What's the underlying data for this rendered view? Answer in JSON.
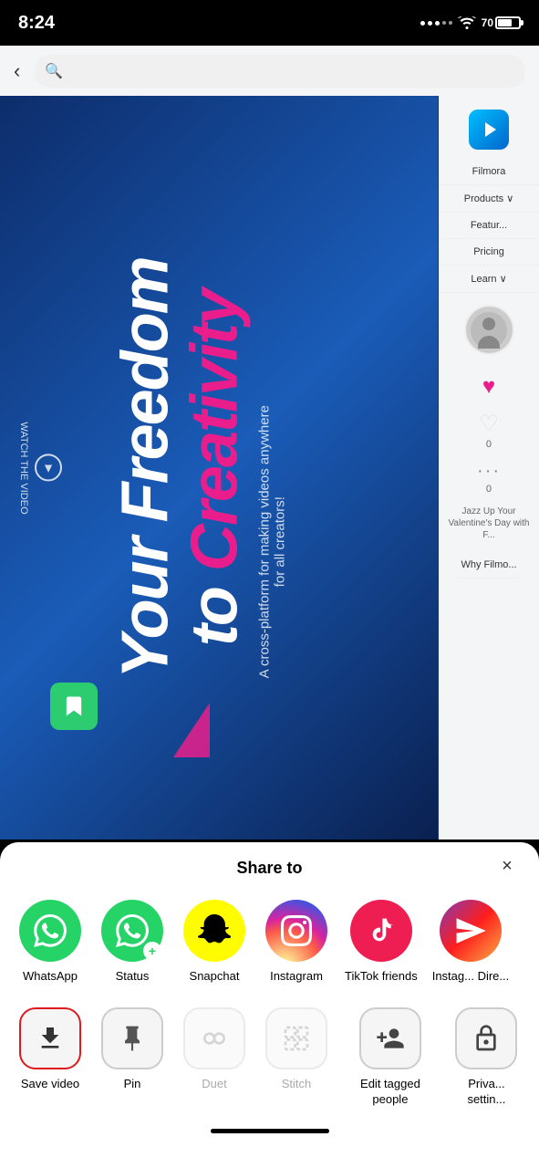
{
  "statusBar": {
    "time": "8:24",
    "batteryLevel": "70"
  },
  "browserNav": {
    "backLabel": "‹",
    "searchPlaceholder": ""
  },
  "heroContent": {
    "watchLabel": "WATCH THE VIDEO",
    "tagline": "A cross-platform for making videos anywhere for all creators!",
    "mainLine1": "Your Freedom",
    "mainLine2": "to Creativity"
  },
  "sidebarNav": {
    "logoAlt": "Filmora",
    "items": [
      {
        "label": "Filmora"
      },
      {
        "label": "Products ∨"
      },
      {
        "label": "Featur..."
      },
      {
        "label": "Pricing"
      },
      {
        "label": "Learn ∨"
      },
      {
        "label": "Why Filmo..."
      }
    ]
  },
  "shareSheet": {
    "title": "Share to",
    "closeLabel": "×",
    "row1": [
      {
        "id": "whatsapp",
        "label": "WhatsApp",
        "colorClass": "bg-whatsapp",
        "icon": "💬"
      },
      {
        "id": "status",
        "label": "Status",
        "colorClass": "bg-status",
        "icon": "🟢"
      },
      {
        "id": "snapchat",
        "label": "Snapchat",
        "colorClass": "bg-snapchat",
        "icon": "👻"
      },
      {
        "id": "instagram",
        "label": "Instagram",
        "colorClass": "bg-instagram",
        "icon": "📸"
      },
      {
        "id": "tiktok-friends",
        "label": "TikTok friends",
        "colorClass": "bg-tiktok",
        "icon": "✈"
      },
      {
        "id": "insta-direct",
        "label": "Instag... Dire...",
        "colorClass": "bg-instadirect",
        "icon": "⇰"
      }
    ],
    "row2": [
      {
        "id": "save-video",
        "label": "Save video",
        "icon": "⬇",
        "selected": true,
        "disabled": false
      },
      {
        "id": "pin",
        "label": "Pin",
        "icon": "📌",
        "selected": false,
        "disabled": false
      },
      {
        "id": "duet",
        "label": "Duet",
        "icon": "⊙",
        "selected": false,
        "disabled": true
      },
      {
        "id": "stitch",
        "label": "Stitch",
        "icon": "⊞",
        "selected": false,
        "disabled": true
      },
      {
        "id": "edit-tagged",
        "label": "Edit tagged people",
        "icon": "👤",
        "selected": false,
        "disabled": false
      },
      {
        "id": "private-settings",
        "label": "Priva... settin...",
        "icon": "🔒",
        "selected": false,
        "disabled": false
      }
    ]
  }
}
